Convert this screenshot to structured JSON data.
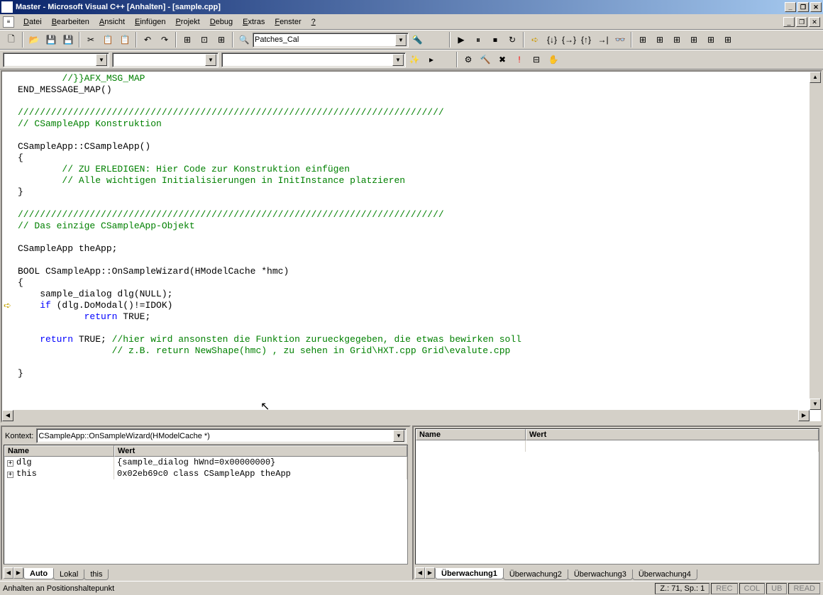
{
  "title": "Master - Microsoft Visual C++ [Anhalten] - [sample.cpp]",
  "menu": [
    "Datei",
    "Bearbeiten",
    "Ansicht",
    "Einfügen",
    "Projekt",
    "Debug",
    "Extras",
    "Fenster",
    "?"
  ],
  "combo_config": "Patches_Cal",
  "code": {
    "lines": [
      {
        "indent": "        ",
        "cmt": "//}}AFX_MSG_MAP"
      },
      {
        "plain": "END_MESSAGE_MAP()"
      },
      {
        "plain": ""
      },
      {
        "cmt": "/////////////////////////////////////////////////////////////////////////////"
      },
      {
        "cmt": "// CSampleApp Konstruktion"
      },
      {
        "plain": ""
      },
      {
        "plain": "CSampleApp::CSampleApp()"
      },
      {
        "plain": "{"
      },
      {
        "indent": "        ",
        "cmt": "// ZU ERLEDIGEN: Hier Code zur Konstruktion einfügen"
      },
      {
        "indent": "        ",
        "cmt": "// Alle wichtigen Initialisierungen in InitInstance platzieren"
      },
      {
        "plain": "}"
      },
      {
        "plain": ""
      },
      {
        "cmt": "/////////////////////////////////////////////////////////////////////////////"
      },
      {
        "cmt": "// Das einzige CSampleApp-Objekt"
      },
      {
        "plain": ""
      },
      {
        "plain": "CSampleApp theApp;"
      },
      {
        "plain": ""
      },
      {
        "plain": "BOOL CSampleApp::OnSampleWizard(HModelCache *hmc)"
      },
      {
        "plain": "{"
      },
      {
        "indent": "    ",
        "plain": "sample_dialog dlg(NULL);"
      },
      {
        "bp": true,
        "indent": "    ",
        "kw": "if",
        "plain": " (dlg.DoModal()!=IDOK)"
      },
      {
        "indent": "            ",
        "kw": "return",
        "plain": " TRUE;"
      },
      {
        "plain": ""
      },
      {
        "indent": "    ",
        "kw": "return",
        "plain": " TRUE; ",
        "cmt": "//hier wird ansonsten die Funktion zurueckgegeben, die etwas bewirken soll"
      },
      {
        "indent": "                 ",
        "cmt": "// z.B. return NewShape(hmc) , zu sehen in Grid\\HXT.cpp Grid\\evalute.cpp"
      },
      {
        "plain": ""
      },
      {
        "plain": "}"
      }
    ]
  },
  "context": {
    "label": "Kontext:",
    "value": "CSampleApp::OnSampleWizard(HModelCache *)"
  },
  "vars_panel": {
    "headers": [
      "Name",
      "Wert"
    ],
    "rows": [
      {
        "name": "dlg",
        "value": "{sample_dialog hWnd=0x00000000}"
      },
      {
        "name": "this",
        "value": "0x02eb69c0 class CSampleApp  theApp"
      }
    ],
    "tabs": [
      "Auto",
      "Lokal",
      "this"
    ],
    "active_tab": 0
  },
  "watch_panel": {
    "headers": [
      "Name",
      "Wert"
    ],
    "tabs": [
      "Überwachung1",
      "Überwachung2",
      "Überwachung3",
      "Überwachung4"
    ],
    "active_tab": 0
  },
  "status": {
    "text": "Anhalten an Positionshaltepunkt",
    "pos": "Z.: 71, Sp.: 1",
    "indicators": [
      "REC",
      "COL",
      "UB",
      "READ"
    ]
  }
}
